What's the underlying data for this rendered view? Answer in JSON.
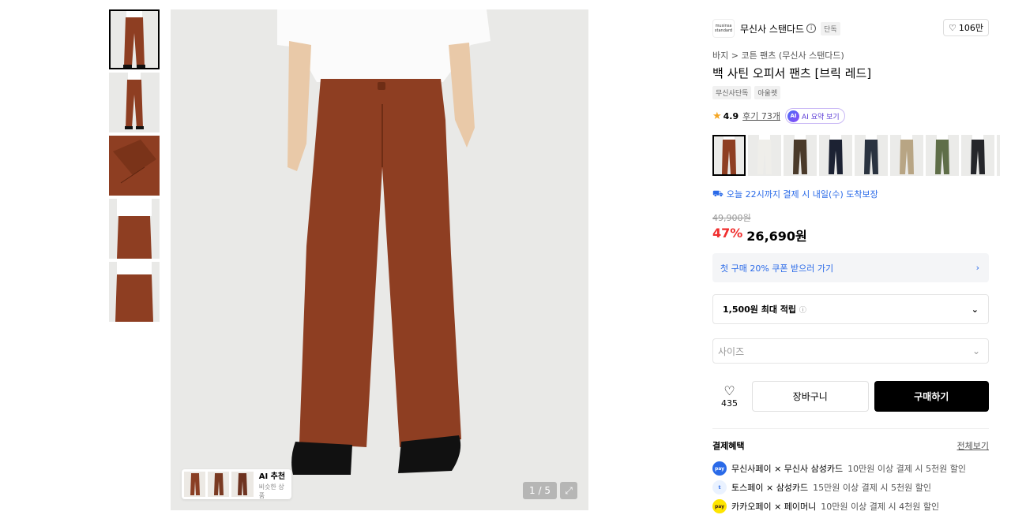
{
  "gallery": {
    "counter": "1 / 5",
    "recommend_title": "AI 추천",
    "recommend_sub": "비슷한 상품"
  },
  "brand": {
    "logo_text": "musinsa standard",
    "name": "무신사 스탠다드",
    "badge": "단독",
    "likes": "106만"
  },
  "product": {
    "breadcrumb": "바지 > 코튼 팬츠 (무신사 스탠다드)",
    "title": "백 사틴 오피서 팬츠 [브릭 레드]",
    "tags": [
      "무신사단독",
      "아울렛"
    ],
    "rating": "4.9",
    "reviews": "후기 73개",
    "ai_summary": "AI 요약 보기",
    "ai_dot": "AI",
    "delivery": "오늘 22시까지 결제 시 내일(수) 도착보장",
    "original_price": "49,900원",
    "discount": "47%",
    "price": "26,690원"
  },
  "color_swatches": [
    "#8e3e22",
    "#efeeea",
    "#4a3a2a",
    "#1c2233",
    "#2a3340",
    "#b8a584",
    "#5f6e48",
    "#25262a",
    "#1a1a1a"
  ],
  "thumbnails_colors": [
    "#8e3e22",
    "#8e3e22",
    "#8e3e22",
    "#8e3e22",
    "#8e3e22"
  ],
  "coupon": "첫 구매 20% 쿠폰 받으러 가기",
  "points": "1,500원 최대 적립",
  "size_placeholder": "사이즈",
  "actions": {
    "wish_count": "435",
    "cart": "장바구니",
    "buy": "구매하기"
  },
  "payment": {
    "title": "결제혜택",
    "more": "전체보기",
    "items": [
      {
        "icon": "musinsa-pay-icon",
        "bold": "무신사페이 × 무신사 삼성카드",
        "desc": "10만원 이상 결제 시 5천원 할인",
        "color": "#2a6ae8",
        "glyph": "pay"
      },
      {
        "icon": "toss-pay-icon",
        "bold": "토스페이 × 삼성카드",
        "desc": "15만원 이상 결제 시 5천원 할인",
        "color": "#eaf2ff",
        "glyph": "t"
      },
      {
        "icon": "kakao-pay-icon",
        "bold": "카카오페이 × 페이머니",
        "desc": "10만원 이상 결제 시 4천원 할인",
        "color": "#fee500",
        "glyph": "pay"
      }
    ]
  }
}
